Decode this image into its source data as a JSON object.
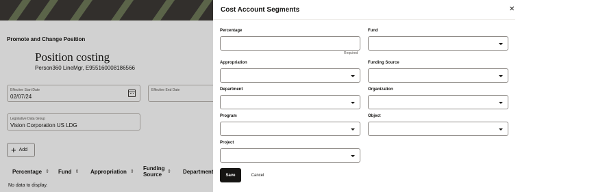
{
  "background": {
    "heading": "Promote and Change Position",
    "title": "Position costing",
    "subtitle": "Person360 LineMgr, E955160008186566",
    "effective_start": {
      "label": "Effective Start Date",
      "value": "02/07/24"
    },
    "effective_end": {
      "label": "Effective End Date",
      "value": ""
    },
    "ldg": {
      "label": "Legislative Data Group",
      "value": "Vision Corporation US LDG"
    },
    "add_label": "Add",
    "table_columns": [
      {
        "label": "Percentage"
      },
      {
        "label": "Fund"
      },
      {
        "label": "Appropriation"
      },
      {
        "label": "Funding Source"
      },
      {
        "label": "Department"
      }
    ],
    "empty_message": "No data to display."
  },
  "drawer": {
    "title": "Cost Account Segments",
    "close_icon": "close-icon",
    "fields": {
      "percentage": {
        "label": "Percentage",
        "value": "",
        "required_text": "Required"
      },
      "fund": {
        "label": "Fund",
        "value": ""
      },
      "appropriation": {
        "label": "Appropriation",
        "value": ""
      },
      "funding_source": {
        "label": "Funding Source",
        "value": ""
      },
      "department": {
        "label": "Department",
        "value": ""
      },
      "organization": {
        "label": "Organization",
        "value": ""
      },
      "program": {
        "label": "Program",
        "value": ""
      },
      "object": {
        "label": "Object",
        "value": ""
      },
      "project": {
        "label": "Project",
        "value": ""
      }
    },
    "save_label": "Save",
    "cancel_label": "Cancel"
  },
  "colors": {
    "primary_button": "#161513",
    "banner": "#3d3a36",
    "scrim": "rgba(0,0,0,0.18)"
  }
}
